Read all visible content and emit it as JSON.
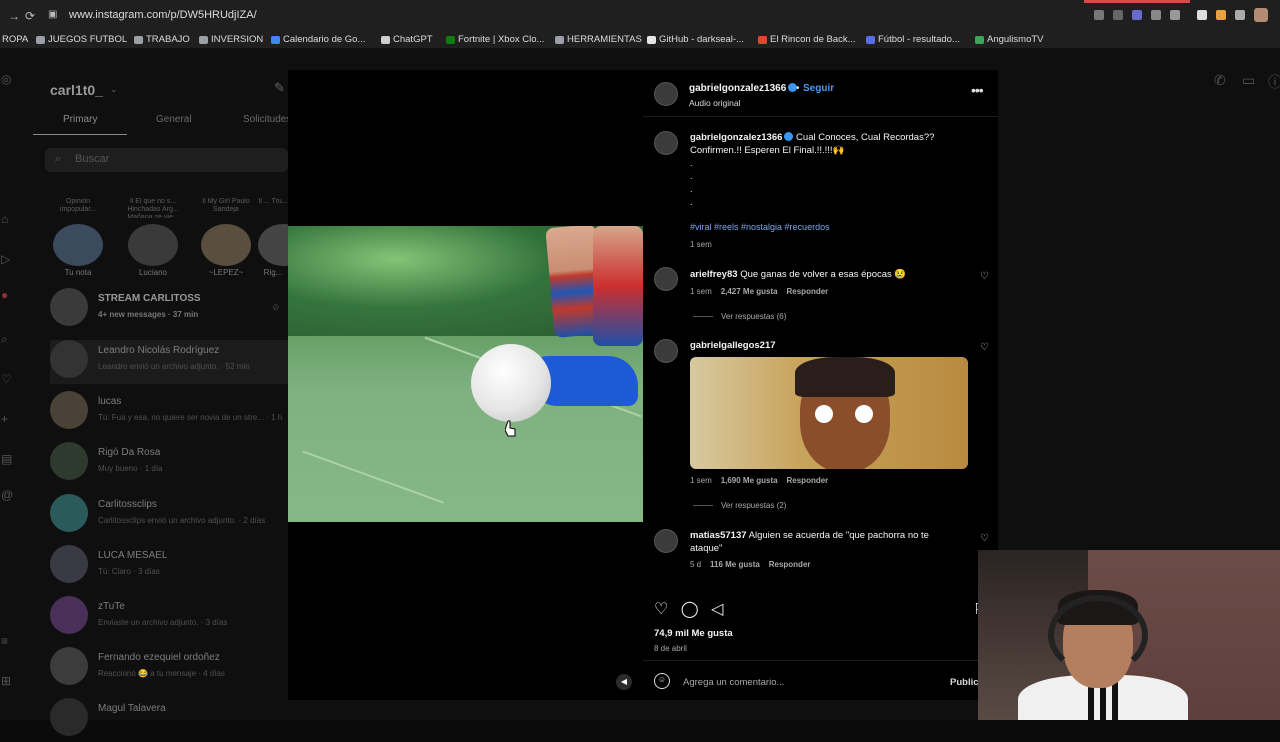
{
  "browser": {
    "url": "www.instagram.com/p/DW5HRUdjIZA/",
    "bookmarks": [
      {
        "label": "ROPA",
        "color": "#1f1f1f"
      },
      {
        "label": "JUEGOS FUTBOL",
        "color": "#9aa0a6"
      },
      {
        "label": "TRABAJO",
        "color": "#9aa0a6"
      },
      {
        "label": "INVERSION",
        "color": "#9aa0a6"
      },
      {
        "label": "Calendario de Go...",
        "color": "#4285f4"
      },
      {
        "label": "ChatGPT",
        "color": "#cfcfcf"
      },
      {
        "label": "Fortnite | Xbox Clo...",
        "color": "#107c10"
      },
      {
        "label": "HERRAMIENTAS",
        "color": "#9aa0a6"
      },
      {
        "label": "GitHub - darkseal-...",
        "color": "#e6e6e6"
      },
      {
        "label": "El Rincon de Back...",
        "color": "#e0452f"
      },
      {
        "label": "Fútbol - resultado...",
        "color": "#5b6ee1"
      },
      {
        "label": "AngulismoTV",
        "color": "#3aa65a"
      }
    ]
  },
  "background_app": {
    "username": "carl1t0_",
    "tabs": [
      "Primary",
      "General",
      "Solicitudes"
    ],
    "search_placeholder": "Buscar",
    "notes": [
      {
        "bubble": "Opinión impopular...",
        "name": "Tu nota"
      },
      {
        "bubble": "Il El que no s... Hinchadas Arg... Mañana se vie...",
        "name": "Luciano"
      },
      {
        "bubble": "Il My Girl Paulo Sandeja",
        "name": "~LEPEZ~"
      },
      {
        "bubble": "Il ... Tru...",
        "name": "Rig..."
      }
    ],
    "chats": [
      {
        "name": "STREAM CARLITOSS",
        "sub": "4+ new messages · 37 min",
        "bold": true
      },
      {
        "name": "Leandro Nicolás Rodríguez",
        "sub": "Leandro envió un archivo adjunto. · 52 min",
        "bold": false
      },
      {
        "name": "lucas",
        "sub": "Tú: Fua y esa, no quiere ser novia de un stre... · 1 h",
        "bold": false
      },
      {
        "name": "Rigó Da Rosa",
        "sub": "Muy bueno · 1 día",
        "bold": false
      },
      {
        "name": "Carlitossclips",
        "sub": "Carlitossclips envió un archivo adjunto. · 2 días",
        "bold": false
      },
      {
        "name": "LUCA MESAEL",
        "sub": "Tú: Claro · 3 días",
        "bold": false
      },
      {
        "name": "zTuTe",
        "sub": "Enviaste un archivo adjunto. · 3 días",
        "bold": false
      },
      {
        "name": "Fernando ezequiel ordoñez",
        "sub": "Reaccionó 😂 a tu mensaje · 4 días",
        "bold": false
      },
      {
        "name": "Magul Talavera",
        "sub": "",
        "bold": false
      }
    ]
  },
  "post": {
    "author": "gabrielgonzalez1366",
    "follow_label": "Seguir",
    "separator": "•",
    "audio": "Audio original",
    "caption": "Cual Conoces, Cual Recordas?? Confirmen.!! Esperen El Final.!!.!!!🙌",
    "caption_dots": [
      ".",
      ".",
      ".",
      "."
    ],
    "hashtags": "#viral #reels #nostalgia #recuerdos",
    "caption_time": "1 sem",
    "comments": [
      {
        "user": "arielfrey83",
        "text": "Que ganas de volver a esas épocas 😢",
        "time": "1 sem",
        "likes": "2,427 Me gusta",
        "reply": "Responder",
        "view": "Ver respuestas (6)"
      },
      {
        "user": "gabrielgallegos217",
        "text": "",
        "time": "1 sem",
        "likes": "1,690 Me gusta",
        "reply": "Responder",
        "view": "Ver respuestas (2)"
      },
      {
        "user": "matias57137",
        "text": "Alguien se acuerda de \"que pachorra no te ataque\"",
        "time": "5 d",
        "likes": "116 Me gusta",
        "reply": "Responder",
        "view": ""
      }
    ],
    "likes_total": "74,9 mil Me gusta",
    "date": "8 de abril",
    "comment_placeholder": "Agrega un comentario...",
    "publish_label": "Publicar"
  }
}
